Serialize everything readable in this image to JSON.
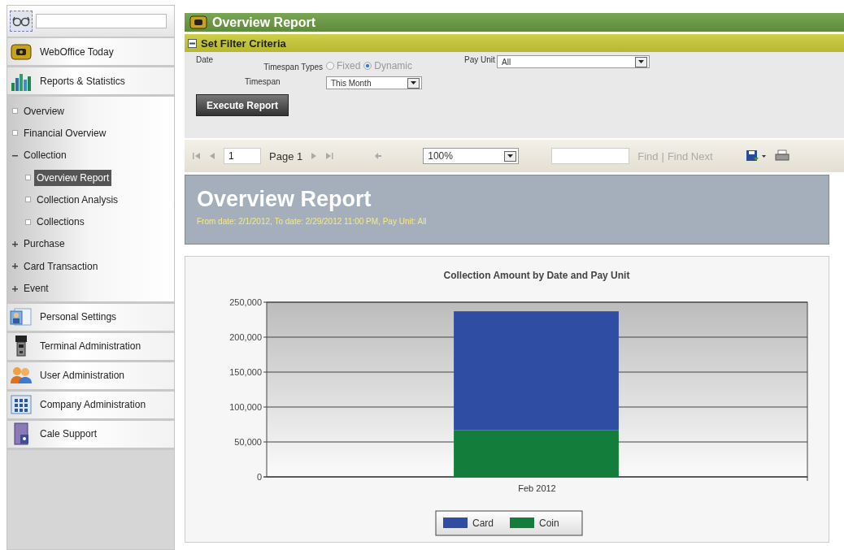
{
  "sidebar": {
    "nav_top": [
      {
        "label": "WebOffice Today"
      },
      {
        "label": "Reports & Statistics"
      }
    ],
    "tree": [
      {
        "label": "Overview",
        "kind": "leaf",
        "selected": false
      },
      {
        "label": "Financial Overview",
        "kind": "leaf",
        "selected": false
      },
      {
        "label": "Collection",
        "kind": "folder",
        "expanded": true,
        "selected": false,
        "children": [
          {
            "label": "Overview Report",
            "kind": "leaf",
            "selected": true
          },
          {
            "label": "Collection Analysis",
            "kind": "leaf",
            "selected": false
          },
          {
            "label": "Collections",
            "kind": "leaf",
            "selected": false
          }
        ]
      },
      {
        "label": "Purchase",
        "kind": "folder",
        "expanded": false,
        "selected": false
      },
      {
        "label": "Card Transaction",
        "kind": "folder",
        "expanded": false,
        "selected": false
      },
      {
        "label": "Event",
        "kind": "folder",
        "expanded": false,
        "selected": false
      }
    ],
    "nav_bottom": [
      {
        "label": "Personal Settings"
      },
      {
        "label": "Terminal Administration"
      },
      {
        "label": "User Administration"
      },
      {
        "label": "Company Administration"
      },
      {
        "label": "Cale Support"
      }
    ]
  },
  "page_title": "Overview Report",
  "filter": {
    "title": "Set Filter Criteria",
    "expanded": true,
    "date_label": "Date",
    "timespan_types": {
      "label": "Timespan Types",
      "options": [
        {
          "label": "Fixed",
          "selected": false
        },
        {
          "label": "Dynamic",
          "selected": true
        }
      ]
    },
    "timespan": {
      "label": "Timespan",
      "value": "This Month"
    },
    "pay_unit": {
      "label": "Pay Unit",
      "value": "All"
    },
    "execute_button": "Execute Report"
  },
  "toolbar": {
    "page_value": "1",
    "page_label": "Page 1",
    "zoom": "100%",
    "find": "Find",
    "separator": "|",
    "find_next": "Find Next"
  },
  "report": {
    "title": "Overview Report",
    "subtitle": "From date: 2/1/2012, To date: 2/29/2012 11:00 PM, Pay Unit: All",
    "chart_data": {
      "type": "bar",
      "title": "Collection Amount by Date and Pay Unit",
      "categories": [
        "Feb 2012"
      ],
      "stacked": true,
      "series": [
        {
          "name": "Card",
          "color": "#2e4da3",
          "values": [
            170000
          ]
        },
        {
          "name": "Coin",
          "color": "#137d3b",
          "values": [
            67000
          ]
        }
      ],
      "grid": true,
      "legend": true,
      "ylim": [
        0,
        250000
      ],
      "yticks": [
        {
          "value": 0,
          "label": "0"
        },
        {
          "value": 50000,
          "label": "50,000"
        },
        {
          "value": 100000,
          "label": "100,000"
        },
        {
          "value": 150000,
          "label": "150,000"
        },
        {
          "value": 200000,
          "label": "200,000"
        },
        {
          "value": 250000,
          "label": "250,000"
        }
      ]
    }
  }
}
